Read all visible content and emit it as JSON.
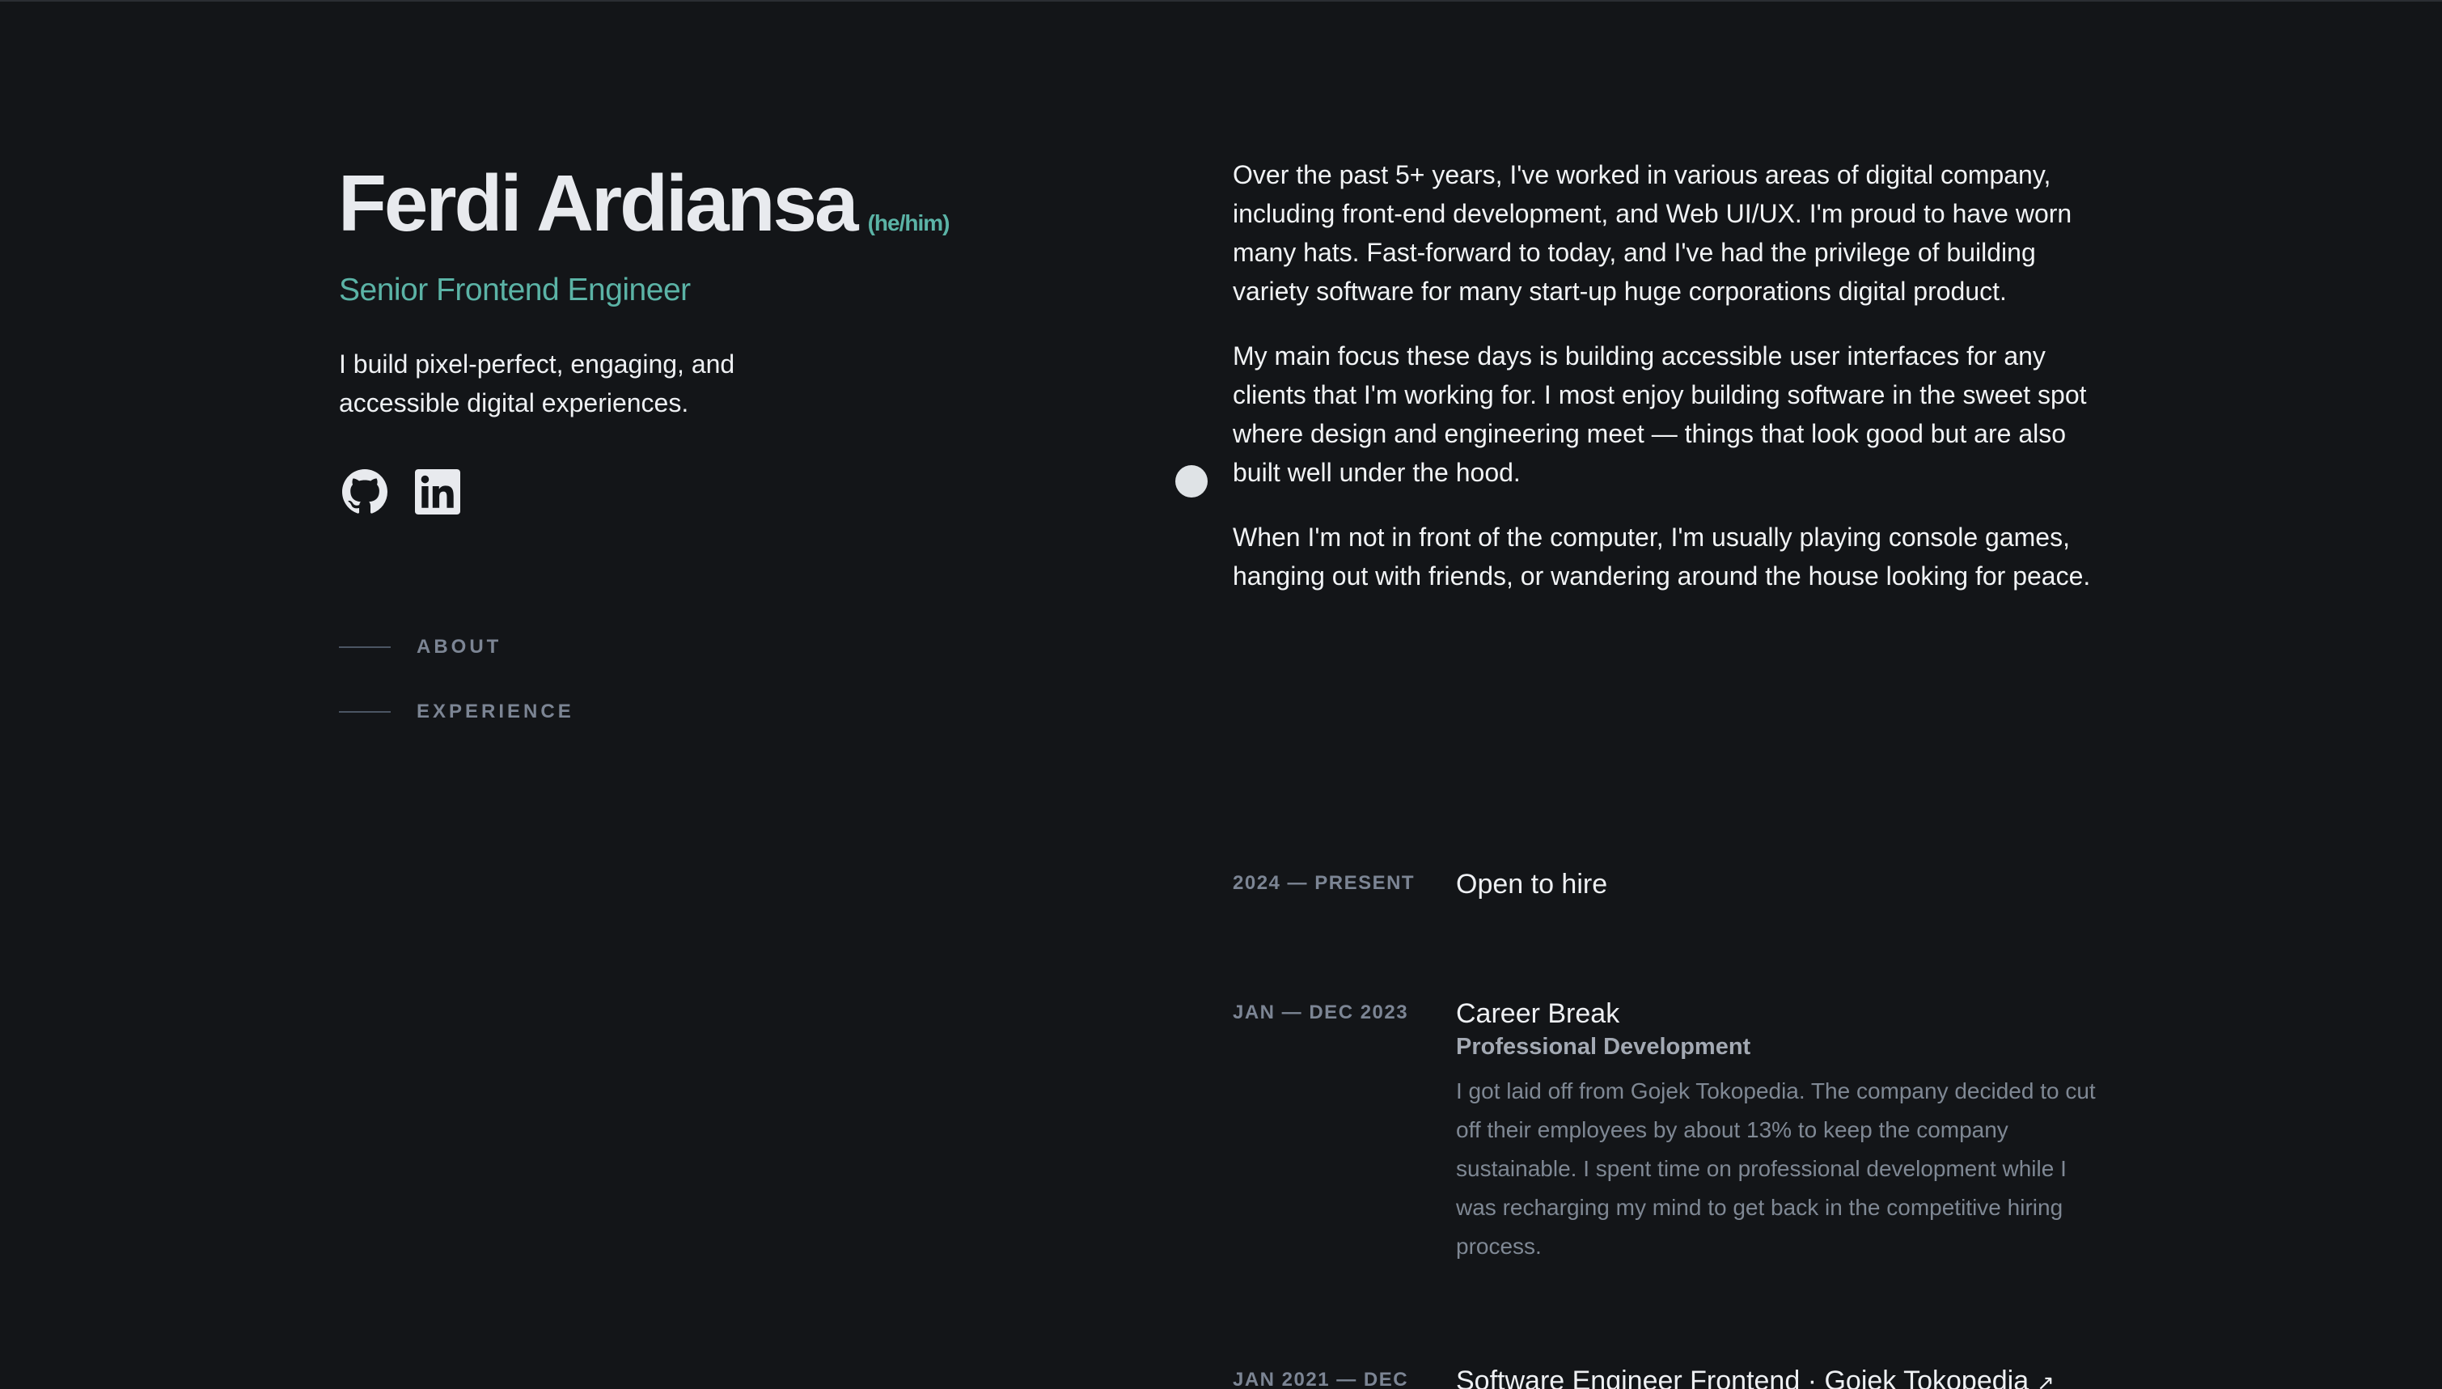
{
  "header": {
    "name": "Ferdi Ardiansa",
    "pronouns": "(he/him)",
    "role": "Senior Frontend Engineer",
    "tagline": "I build pixel-perfect, engaging, and accessible digital experiences."
  },
  "social": [
    {
      "icon": "github-icon"
    },
    {
      "icon": "linkedin-icon"
    }
  ],
  "nav": {
    "items": [
      {
        "label": "ABOUT"
      },
      {
        "label": "EXPERIENCE"
      }
    ]
  },
  "about": {
    "paragraphs": [
      "Over the past 5+ years, I've worked in various areas of digital company, including front-end development, and Web UI/UX. I'm proud to have worn many hats. Fast-forward to today, and I've had the privilege of building variety software for many start-up huge corporations digital product.",
      "My main focus these days is building accessible user interfaces for any clients that I'm working for. I most enjoy building software in the sweet spot where design and engineering meet — things that look good but are also built well under the hood.",
      "When I'm not in front of the computer, I'm usually playing console games, hanging out with friends, or wandering around the house looking for peace."
    ]
  },
  "experience": [
    {
      "date": "2024 — PRESENT",
      "title": "Open to hire"
    },
    {
      "date": "JAN — DEC 2023",
      "title": "Career Break",
      "subtitle": "Professional Development",
      "description": "I got laid off from Gojek Tokopedia. The company decided to cut off their employees by about 13% to keep the company sustainable. I spent time on professional development while I was recharging my mind to get back in the competitive hiring process."
    },
    {
      "date": "JAN 2021 — DEC",
      "title": "Software Engineer Frontend · Gojek Tokopedia",
      "arrow": "↗"
    }
  ],
  "colors": {
    "background": "#131518",
    "accent": "#5bb3a6",
    "muted": "#7c8594"
  }
}
